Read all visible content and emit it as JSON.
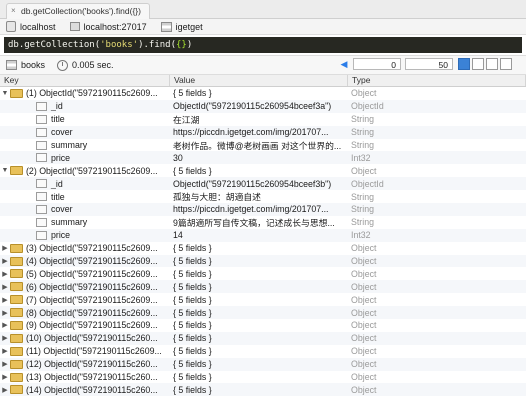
{
  "tab": {
    "label": "db.getCollection('books').find({})"
  },
  "connection": {
    "host": "localhost",
    "server": "localhost:27017",
    "db": "igetget"
  },
  "query": {
    "pre": "db.getCollection(",
    "str": "'books'",
    "mid": ").find(",
    "brace": "{}",
    "post": ")"
  },
  "toolbar": {
    "collection": "books",
    "time": "0.005 sec.",
    "skip": "0",
    "limit": "50"
  },
  "columns": {
    "key": "Key",
    "value": "Value",
    "type": "Type"
  },
  "rows": [
    {
      "level": 0,
      "expand": "down",
      "key": "(1) ObjectId(\"5972190115c2609...",
      "value": "{ 5 fields }",
      "type": "Object"
    },
    {
      "level": 1,
      "key": "_id",
      "value": "ObjectId(\"5972190115c260954bceef3a\")",
      "type": "ObjectId"
    },
    {
      "level": 1,
      "key": "title",
      "value": "在江湖",
      "type": "String"
    },
    {
      "level": 1,
      "key": "cover",
      "value": "https://piccdn.igetget.com/img/201707...",
      "type": "String"
    },
    {
      "level": 1,
      "key": "summary",
      "value": "老树作品。微博@老树画画 对这个世界的...",
      "type": "String"
    },
    {
      "level": 1,
      "key": "price",
      "value": "30",
      "type": "Int32"
    },
    {
      "level": 0,
      "expand": "down",
      "key": "(2) ObjectId(\"5972190115c2609...",
      "value": "{ 5 fields }",
      "type": "Object"
    },
    {
      "level": 1,
      "key": "_id",
      "value": "ObjectId(\"5972190115c260954bceef3b\")",
      "type": "ObjectId"
    },
    {
      "level": 1,
      "key": "title",
      "value": "孤独与大胆：胡適自述",
      "type": "String"
    },
    {
      "level": 1,
      "key": "cover",
      "value": "https://piccdn.igetget.com/img/201707...",
      "type": "String"
    },
    {
      "level": 1,
      "key": "summary",
      "value": "9篇胡適所写自传文稿，记述成长与思想...",
      "type": "String"
    },
    {
      "level": 1,
      "key": "price",
      "value": "14",
      "type": "Int32"
    },
    {
      "level": 0,
      "expand": "right",
      "key": "(3) ObjectId(\"5972190115c2609...",
      "value": "{ 5 fields }",
      "type": "Object"
    },
    {
      "level": 0,
      "expand": "right",
      "key": "(4) ObjectId(\"5972190115c2609...",
      "value": "{ 5 fields }",
      "type": "Object"
    },
    {
      "level": 0,
      "expand": "right",
      "key": "(5) ObjectId(\"5972190115c2609...",
      "value": "{ 5 fields }",
      "type": "Object"
    },
    {
      "level": 0,
      "expand": "right",
      "key": "(6) ObjectId(\"5972190115c2609...",
      "value": "{ 5 fields }",
      "type": "Object"
    },
    {
      "level": 0,
      "expand": "right",
      "key": "(7) ObjectId(\"5972190115c2609...",
      "value": "{ 5 fields }",
      "type": "Object"
    },
    {
      "level": 0,
      "expand": "right",
      "key": "(8) ObjectId(\"5972190115c2609...",
      "value": "{ 5 fields }",
      "type": "Object"
    },
    {
      "level": 0,
      "expand": "right",
      "key": "(9) ObjectId(\"5972190115c2609...",
      "value": "{ 5 fields }",
      "type": "Object"
    },
    {
      "level": 0,
      "expand": "right",
      "key": "(10) ObjectId(\"5972190115c260...",
      "value": "{ 5 fields }",
      "type": "Object"
    },
    {
      "level": 0,
      "expand": "right",
      "key": "(11) ObjectId(\"5972190115c2609...",
      "value": "{ 5 fields }",
      "type": "Object"
    },
    {
      "level": 0,
      "expand": "right",
      "key": "(12) ObjectId(\"5972190115c260...",
      "value": "{ 5 fields }",
      "type": "Object"
    },
    {
      "level": 0,
      "expand": "right",
      "key": "(13) ObjectId(\"5972190115c260...",
      "value": "{ 5 fields }",
      "type": "Object"
    },
    {
      "level": 0,
      "expand": "right",
      "key": "(14) ObjectId(\"5972190115c260...",
      "value": "{ 5 fields }",
      "type": "Object"
    }
  ]
}
